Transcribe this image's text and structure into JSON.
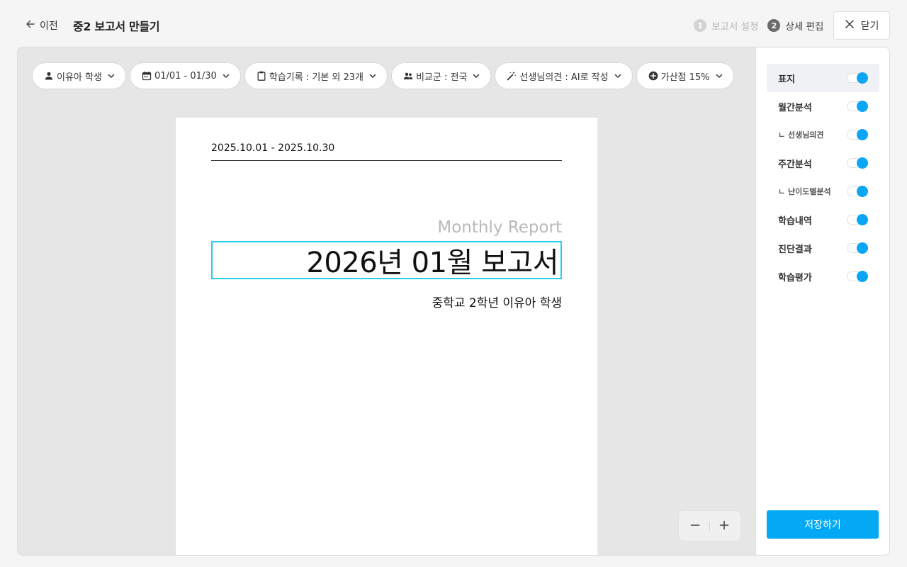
{
  "header": {
    "back_label": "이전",
    "title": "중2 보고서 만들기",
    "steps": [
      {
        "num": "1",
        "label": "보고서 설정"
      },
      {
        "num": "2",
        "label": "상세 편집"
      }
    ],
    "close_label": "닫기"
  },
  "filters": [
    {
      "icon": "person-icon",
      "label": "이유아 학생"
    },
    {
      "icon": "calendar-icon",
      "label": "01/01 - 01/30"
    },
    {
      "icon": "clipboard-icon",
      "label": "학습기록 : 기본 외 23개"
    },
    {
      "icon": "group-icon",
      "label": "비교군 : 전국"
    },
    {
      "icon": "magic-wand-icon",
      "label": "선생님의견 : AI로 작성"
    },
    {
      "icon": "plus-circle-icon",
      "label": "가산점 15%"
    }
  ],
  "report": {
    "period": "2025.10.01 - 2025.10.30",
    "subtitle_en": "Monthly Report",
    "title": "2026년 01월 보고서",
    "student": "중학교 2학년 이유아 학생"
  },
  "sections": [
    {
      "label": "표지",
      "on": true
    },
    {
      "label": "월간분석",
      "on": true
    },
    {
      "label": "ㄴ 선생님의견",
      "on": true
    },
    {
      "label": "주간분석",
      "on": true
    },
    {
      "label": "ㄴ 난이도별분석",
      "on": true
    },
    {
      "label": "학습내역",
      "on": true
    },
    {
      "label": "진단결과",
      "on": true
    },
    {
      "label": "학습평가",
      "on": true
    }
  ],
  "save_label": "저장하기",
  "colors": {
    "accent": "#04a9f5",
    "title_box_border": "#27cde2"
  }
}
